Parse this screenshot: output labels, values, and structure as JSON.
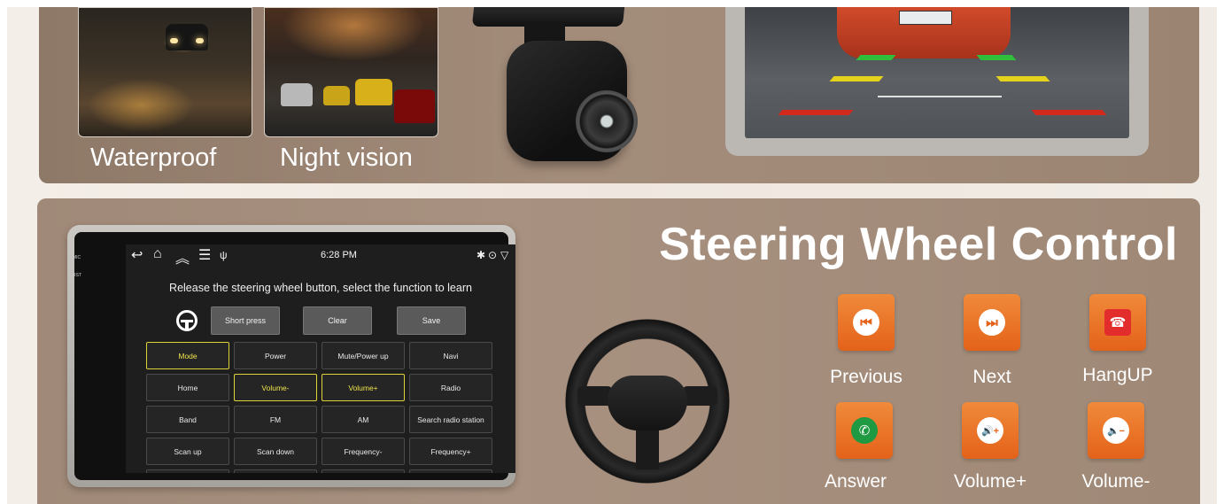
{
  "top": {
    "captions": {
      "waterproof": "Waterproof",
      "night_vision": "Night vision"
    }
  },
  "head_unit": {
    "side_labels": {
      "mic": "MIC",
      "rst": "RST"
    },
    "status": {
      "time": "6:28 PM"
    },
    "icons": [
      "back-icon",
      "home-icon",
      "double-chevron-up-icon",
      "menu-icon",
      "usb-icon",
      "bluetooth-icon",
      "location-icon",
      "wifi-icon"
    ],
    "instruction": "Release the steering wheel button, select the function to learn",
    "buttons": {
      "short_press": "Short press",
      "clear": "Clear",
      "save": "Save"
    },
    "functions": [
      [
        "Mode",
        "Power",
        "Mute/Power up",
        "Navi"
      ],
      [
        "Home",
        "Volume-",
        "Volume+",
        "Radio"
      ],
      [
        "Band",
        "FM",
        "AM",
        "Search radio station"
      ],
      [
        "Scan up",
        "Scan down",
        "Frequency-",
        "Frequency+"
      ]
    ],
    "selected": [
      "Mode",
      "Volume-",
      "Volume+"
    ]
  },
  "steering": {
    "title": "Steering Wheel Control",
    "controls": [
      {
        "label": "Previous",
        "icon": "previous-icon",
        "glyph": "⏮"
      },
      {
        "label": "Next",
        "icon": "next-icon",
        "glyph": "⏭"
      },
      {
        "label": "HangUP",
        "icon": "hang-up-icon",
        "glyph": "☎"
      },
      {
        "label": "Answer",
        "icon": "answer-call-icon",
        "glyph": "✆"
      },
      {
        "label": "Volume+",
        "icon": "volume-up-icon",
        "glyph": "🔊+"
      },
      {
        "label": "Volume-",
        "icon": "volume-down-icon",
        "glyph": "🔈−"
      }
    ]
  },
  "colors": {
    "accent_orange": "#e4621a",
    "panel_brown": "#a38c7a",
    "selected_yellow": "#e0d23a"
  }
}
